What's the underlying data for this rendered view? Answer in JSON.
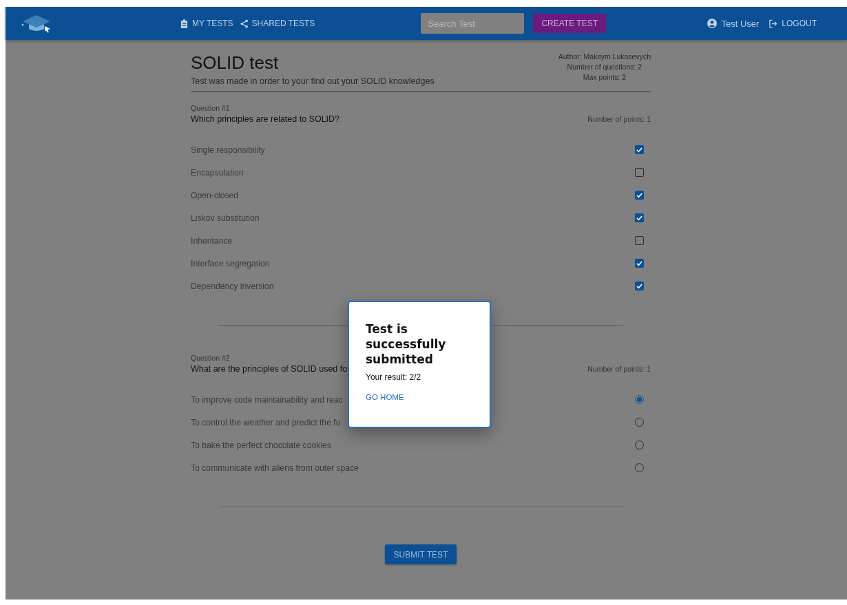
{
  "navbar": {
    "nav_links": [
      "MY TESTS",
      "SHARED TESTS"
    ],
    "search": {
      "placeholder": "Search Test"
    },
    "create_button": "CREATE TEST",
    "user": "Test User",
    "logout": "LOGOUT"
  },
  "test": {
    "title": "SOLID test",
    "description": "Test was made in order to your find out your SOLID knowledges",
    "author": "Author: Maksym Lukasevych",
    "questions_count": "Number of questions: 2",
    "max_points": "Max points: 2"
  },
  "questions": [
    {
      "number": "Question #1",
      "text": "Which principles are related to SOLID?",
      "points": "Number of points: 1",
      "kind": "checkbox",
      "options": [
        {
          "label": "Single responsibility",
          "checked": true
        },
        {
          "label": "Encapsulation",
          "checked": false
        },
        {
          "label": "Open-closed",
          "checked": true
        },
        {
          "label": "Liskov substitution",
          "checked": true
        },
        {
          "label": "Inheritance",
          "checked": false
        },
        {
          "label": "Interface segregation",
          "checked": true
        },
        {
          "label": "Dependency inversion",
          "checked": true
        }
      ]
    },
    {
      "number": "Question #2",
      "text": "What are the principles of SOLID used fo",
      "points": "Number of points: 1",
      "kind": "radio",
      "options": [
        {
          "label": "To improve code maintainability and reac",
          "selected": true
        },
        {
          "label": "To control the weather and predict the fu",
          "selected": false
        },
        {
          "label": "To bake the perfect chocolate cookies",
          "selected": false
        },
        {
          "label": "To communicate with aliens from outer space",
          "selected": false
        }
      ]
    }
  ],
  "submit_button": "SUBMIT TEST",
  "dialog": {
    "title": "Test is successfully submitted",
    "result": "Your result: 2/2",
    "button": "GO HOME"
  }
}
